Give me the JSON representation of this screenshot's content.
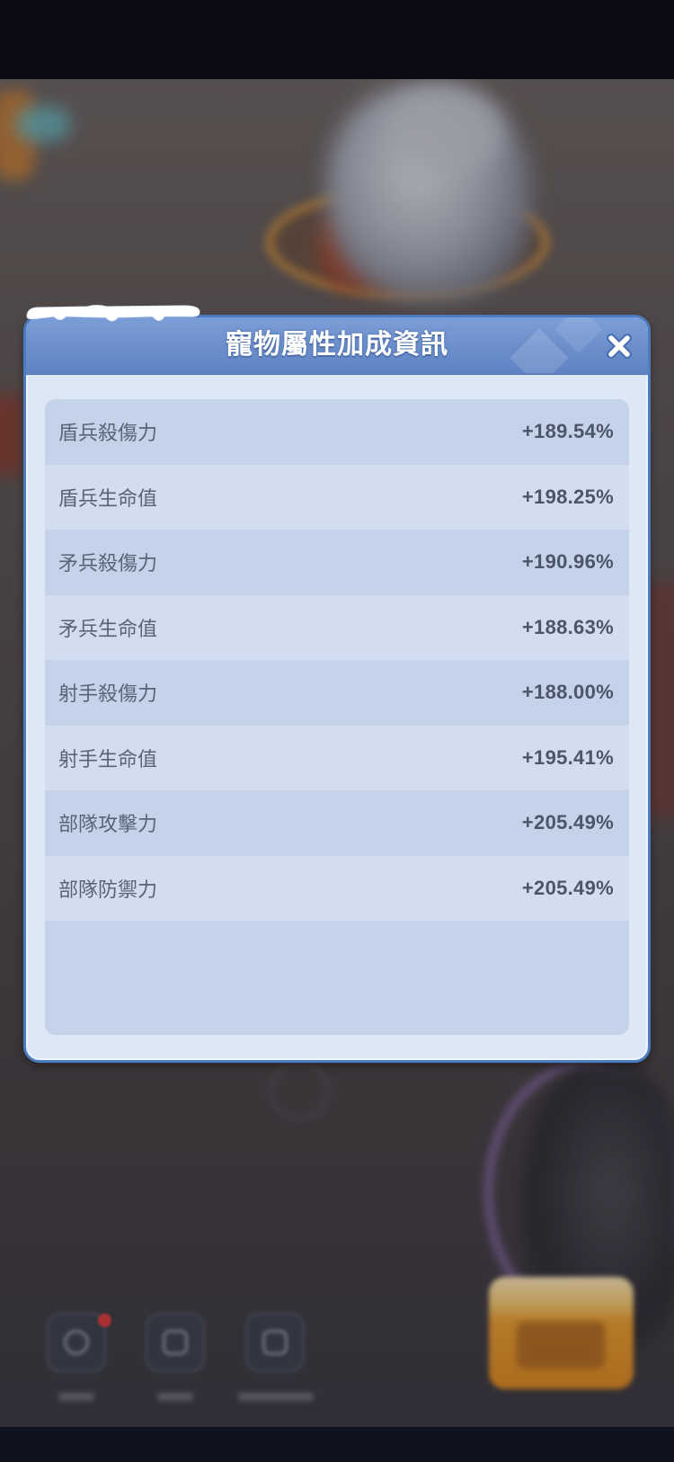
{
  "dialog": {
    "title": "寵物屬性加成資訊",
    "close_icon": "close-icon"
  },
  "stats": [
    {
      "label": "盾兵殺傷力",
      "value": "+189.54%"
    },
    {
      "label": "盾兵生命值",
      "value": "+198.25%"
    },
    {
      "label": "矛兵殺傷力",
      "value": "+190.96%"
    },
    {
      "label": "矛兵生命值",
      "value": "+188.63%"
    },
    {
      "label": "射手殺傷力",
      "value": "+188.00%"
    },
    {
      "label": "射手生命值",
      "value": "+195.41%"
    },
    {
      "label": "部隊攻擊力",
      "value": "+205.49%"
    },
    {
      "label": "部隊防禦力",
      "value": "+205.49%"
    }
  ],
  "background": {
    "bottom_buttons": [
      {
        "icon": "timer-icon",
        "has_notification": true
      },
      {
        "icon": "card-icon",
        "has_notification": false
      },
      {
        "icon": "box-icon",
        "has_notification": false
      }
    ]
  },
  "colors": {
    "header": "#6a8dca",
    "dialog_body": "#dde7f6",
    "row_dark": "#c4d3ea",
    "row_light": "#d2ddef",
    "label_text": "#5a6477",
    "value_text": "#4d5568",
    "title_text": "#ffffff"
  }
}
